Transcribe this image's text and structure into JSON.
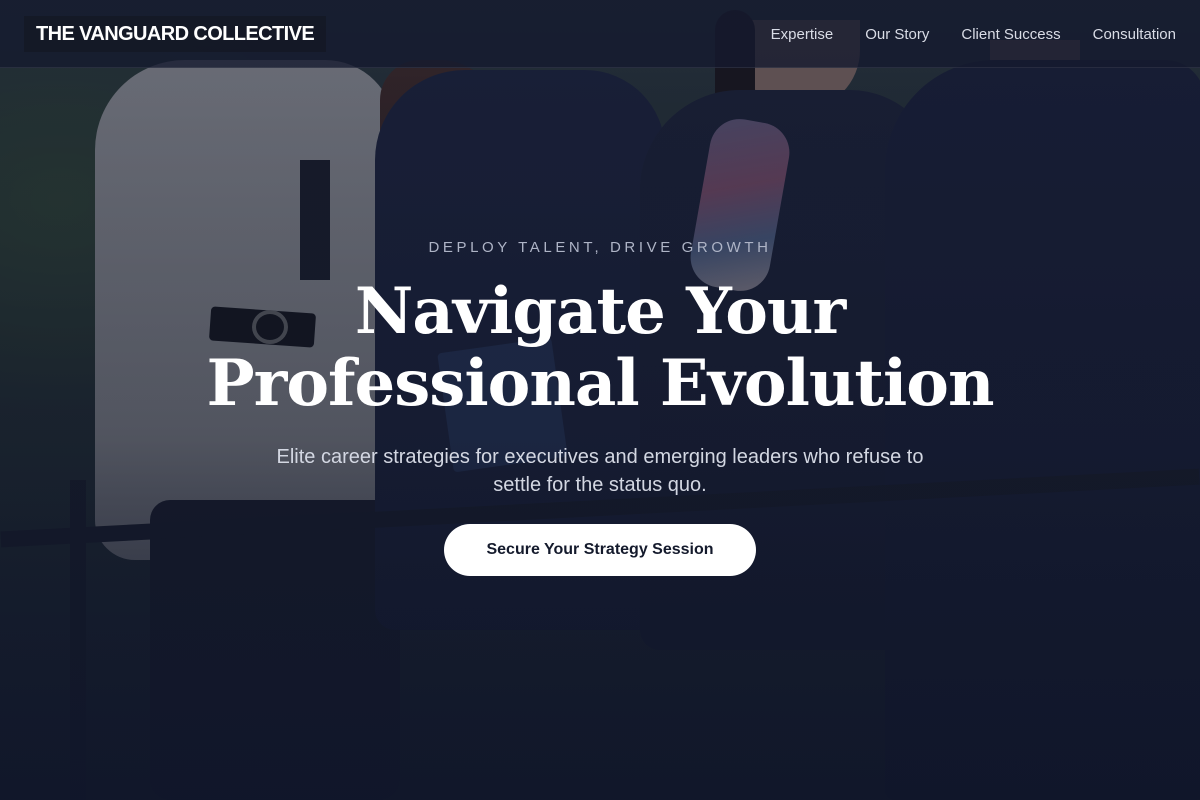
{
  "header": {
    "logo_text": "THE VANGUARD COLLECTIVE",
    "nav": [
      {
        "label": "Expertise"
      },
      {
        "label": "Our Story"
      },
      {
        "label": "Client Success"
      },
      {
        "label": "Consultation"
      }
    ]
  },
  "hero": {
    "eyebrow": "DEPLOY TALENT, DRIVE GROWTH",
    "headline_line1": "Navigate Your",
    "headline_line2": "Professional Evolution",
    "subhead": "Elite career strategies for executives and emerging leaders who refuse to settle for the status quo.",
    "cta_label": "Secure Your Strategy Session",
    "background_image": "group-of-professional-women-in-business-suits"
  },
  "colors": {
    "overlay": "#10162a",
    "cta_background": "#ffffff",
    "cta_text": "#141a2c",
    "headline": "#ffffff"
  }
}
